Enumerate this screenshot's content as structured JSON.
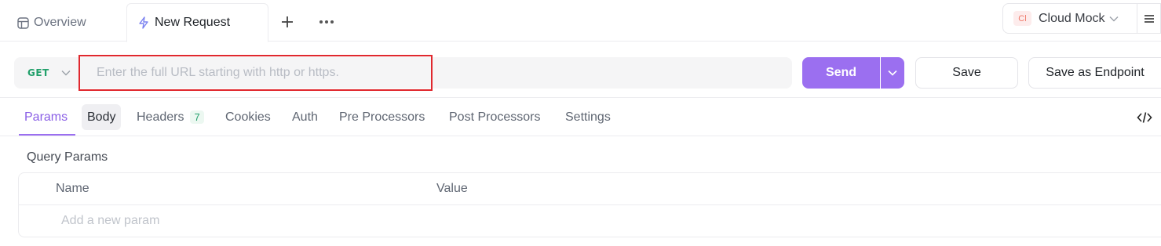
{
  "tabs": {
    "overview_label": "Overview",
    "new_request_label": "New Request",
    "add_tab_icon": "plus-icon",
    "more_icon": "ellipsis-icon"
  },
  "environment": {
    "badge": "Cl",
    "name": "Cloud Mock",
    "badge_color": "#f07a6b"
  },
  "request": {
    "method": "GET",
    "url_value": "",
    "url_placeholder": "Enter the full URL starting with http or https.",
    "send_label": "Send",
    "save_label": "Save",
    "save_endpoint_label": "Save as Endpoint",
    "accent_color": "#9b6ff0"
  },
  "subtabs": {
    "params": "Params",
    "body": "Body",
    "headers": "Headers",
    "headers_count": "7",
    "cookies": "Cookies",
    "auth": "Auth",
    "pre_processors": "Pre Processors",
    "post_processors": "Post Processors",
    "settings": "Settings"
  },
  "query_params": {
    "title": "Query Params",
    "col_name": "Name",
    "col_value": "Value",
    "new_param_placeholder": "Add a new param"
  }
}
